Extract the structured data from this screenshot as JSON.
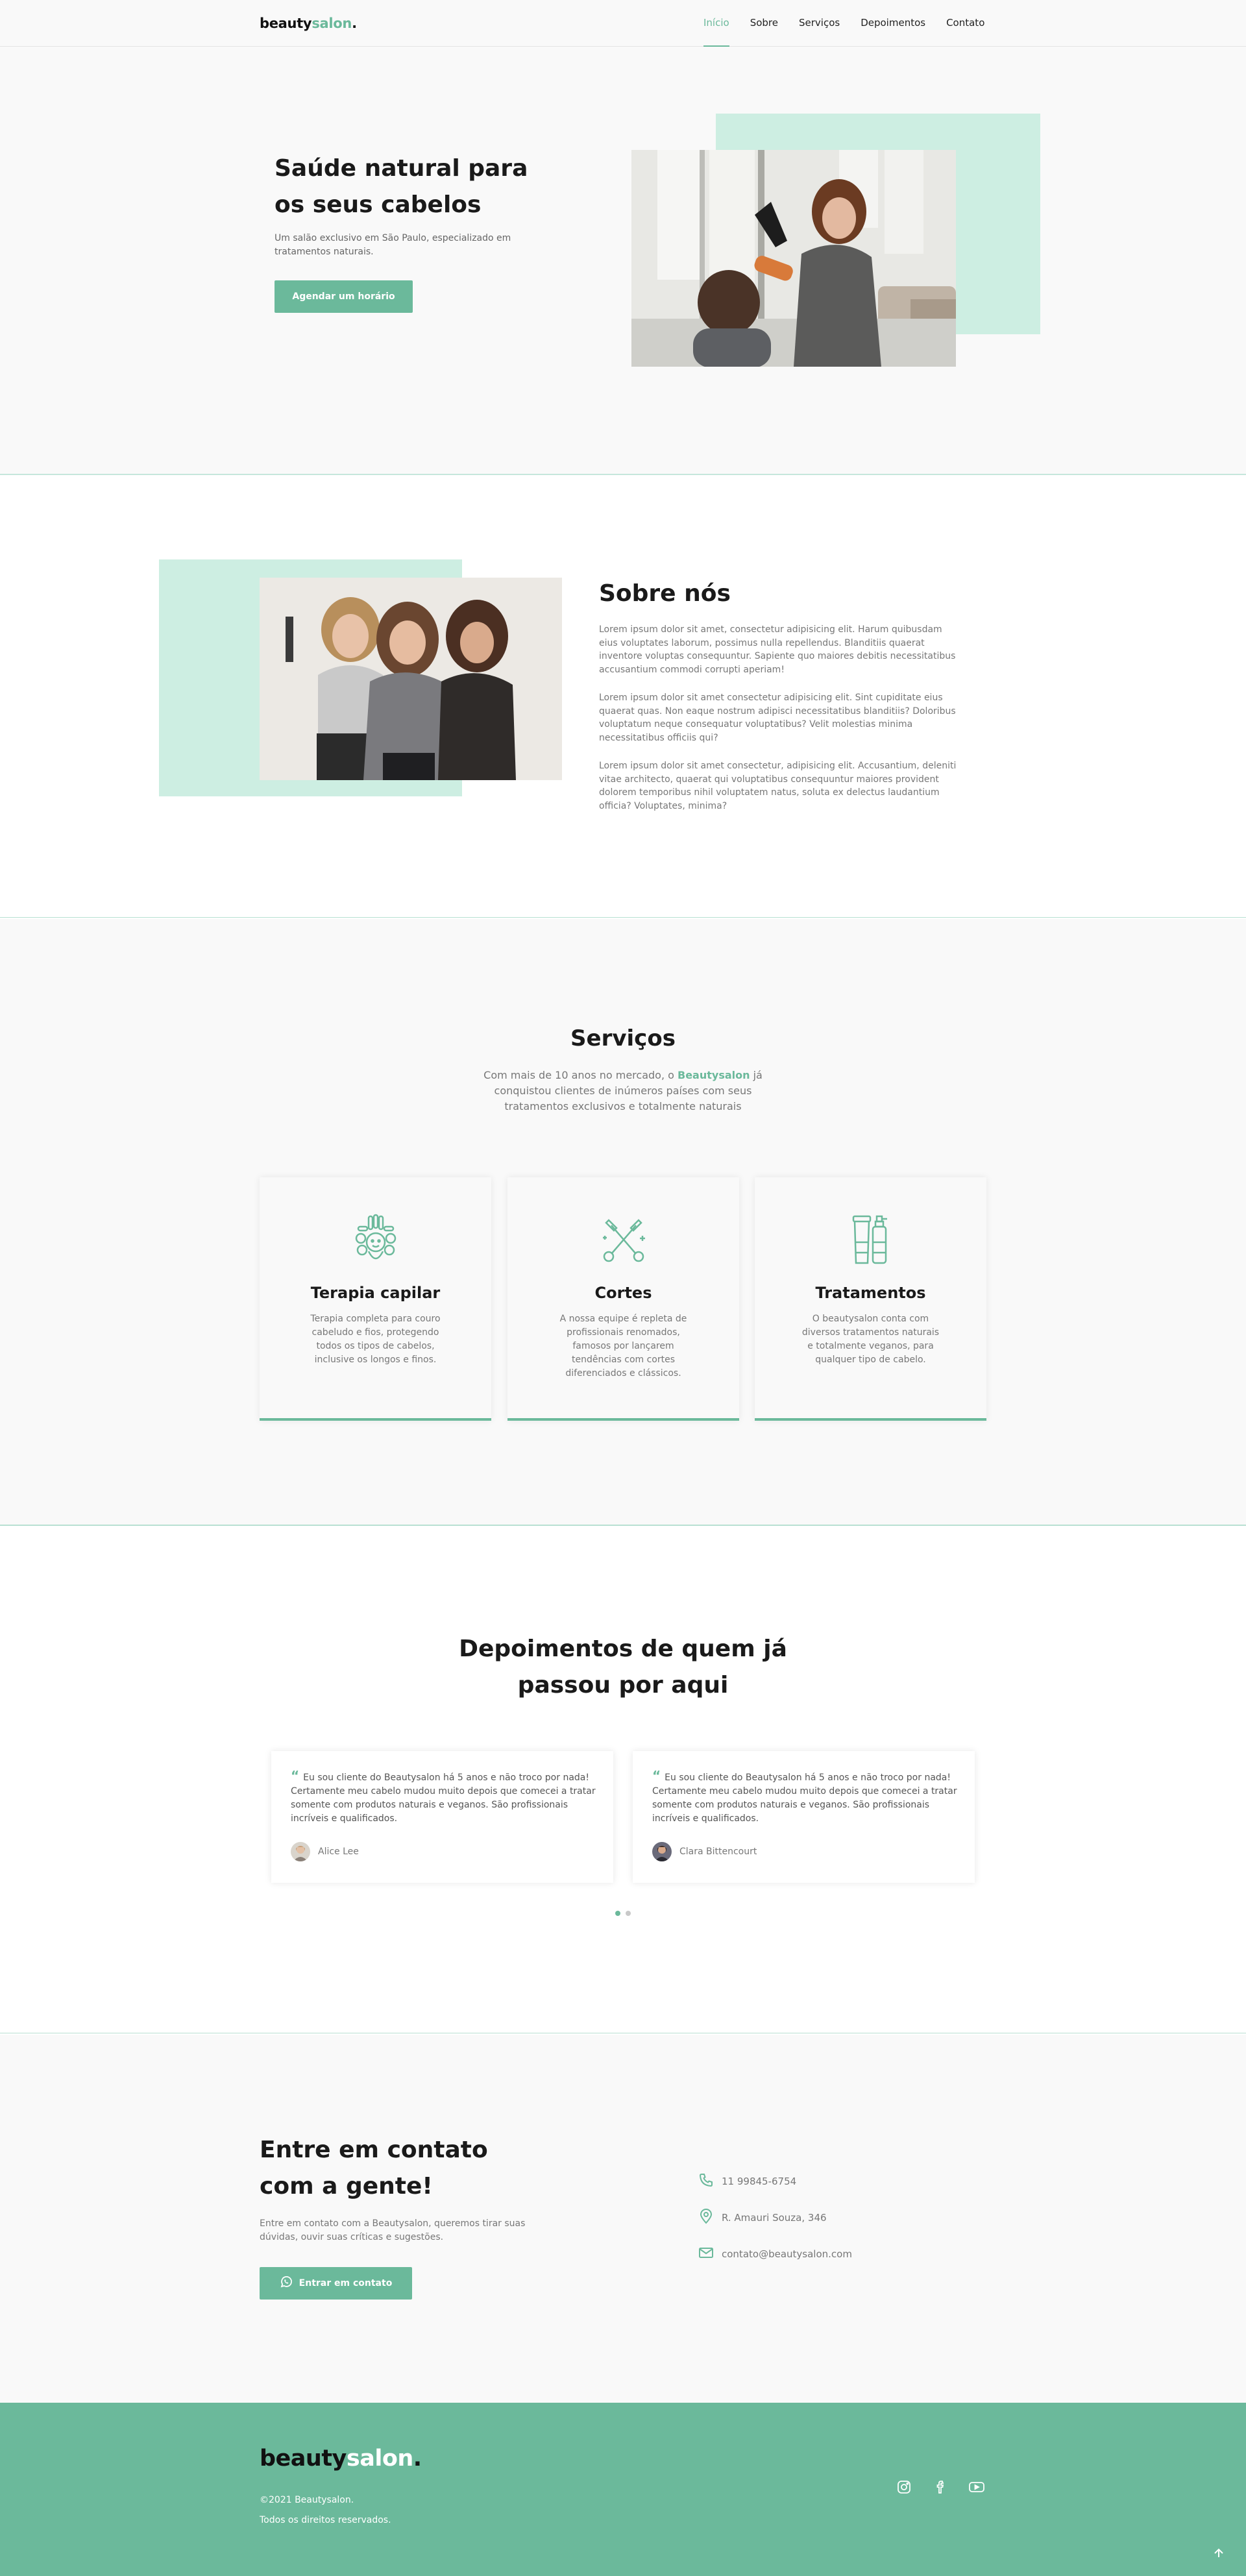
{
  "header": {
    "logo_main": "beauty",
    "logo_accent": "salon",
    "logo_dot": ".",
    "nav": [
      "Início",
      "Sobre",
      "Serviços",
      "Depoimentos",
      "Contato"
    ]
  },
  "hero": {
    "title": "Saúde natural para os seus cabelos",
    "text": "Um salão exclusivo em São Paulo, especializado em tratamentos naturais.",
    "button": "Agendar um horário"
  },
  "about": {
    "title": "Sobre nós",
    "paragraphs": [
      "Lorem ipsum dolor sit amet, consectetur adipisicing elit. Harum quibusdam eius voluptates laborum, possimus nulla repellendus. Blanditiis quaerat inventore voluptas consequuntur. Sapiente quo maiores debitis necessitatibus accusantium commodi corrupti aperiam!",
      "Lorem ipsum dolor sit amet consectetur adipisicing elit. Sint cupiditate eius quaerat quas. Non eaque nostrum adipisci necessitatibus blanditiis? Doloribus voluptatum neque consequatur voluptatibus? Velit molestias minima necessitatibus officiis qui?",
      "Lorem ipsum dolor sit amet consectetur, adipisicing elit. Accusantium, deleniti vitae architecto, quaerat qui voluptatibus consequuntur maiores provident dolorem temporibus nihil voluptatem natus, soluta ex delectus laudantium officia? Voluptates, minima?"
    ]
  },
  "services": {
    "title": "Serviços",
    "intro_before": "Com mais de 10 anos no mercado, o ",
    "intro_brand": "Beautysalon",
    "intro_after": " já conquistou clientes de inúmeros países com seus tratamentos exclusivos e totalmente naturais",
    "cards": [
      {
        "icon": "hair-treatment-icon",
        "title": "Terapia capilar",
        "text": "Terapia completa para couro cabeludo e fios, protegendo todos os tipos de cabelos, inclusive os longos e finos."
      },
      {
        "icon": "scissors-icon",
        "title": "Cortes",
        "text": "A nossa equipe é repleta de profissionais renomados, famosos por lançarem tendências com cortes diferenciados e clássicos."
      },
      {
        "icon": "cosmetics-bottles-icon",
        "title": "Tratamentos",
        "text": "O beautysalon conta com diversos tratamentos naturais e totalmente veganos, para qualquer tipo de cabelo."
      }
    ]
  },
  "testimonials": {
    "title": "Depoimentos de quem já passou por aqui",
    "quote_mark": "“",
    "items": [
      {
        "text": "Eu sou cliente do Beautysalon há 5 anos e não troco por nada! Certamente meu cabelo mudou muito depois que comecei a tratar somente com produtos naturais e veganos. São profissionais incríveis e qualificados.",
        "name": "Alice Lee"
      },
      {
        "text": "Eu sou cliente do Beautysalon há 5 anos e não troco por nada! Certamente meu cabelo mudou muito depois que comecei a tratar somente com produtos naturais e veganos. São profissionais incríveis e qualificados.",
        "name": "Clara Bittencourt"
      }
    ],
    "active_page": 1,
    "pages": 2
  },
  "contact": {
    "title": "Entre em contato com a gente!",
    "text": "Entre em contato com a Beautysalon, queremos tirar suas dúvidas, ouvir suas críticas e sugestões.",
    "button": "Entrar em contato",
    "phone": "11 99845-6754",
    "address": "R. Amauri Souza, 346",
    "email": "contato@beautysalon.com"
  },
  "footer": {
    "logo_main": "beauty",
    "logo_accent": "salon",
    "logo_dot": ".",
    "copyright": "©2021 Beautysalon.",
    "rights": "Todos os direitos reservados."
  },
  "colors": {
    "accent": "#6bb99b",
    "accent_light": "#cdeee2",
    "background": "#f9f9f9",
    "heading": "#1a1a1a"
  }
}
